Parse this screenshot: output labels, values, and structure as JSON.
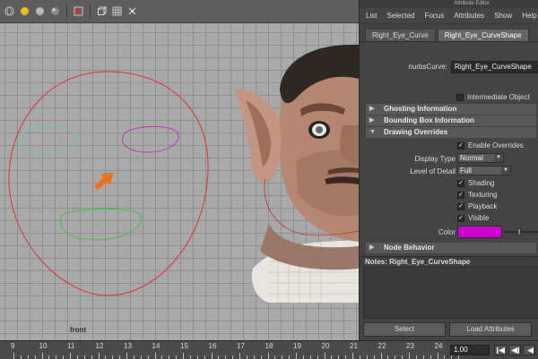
{
  "viewport": {
    "camera_label": "front",
    "toolbar_icons": [
      "wireframe-sphere-icon",
      "smooth-shade-yellow-icon",
      "smooth-shade-gray-icon",
      "shaded-sphere-icon",
      "xray-icon",
      "cube-icon",
      "grid-icon",
      "joint-icon"
    ]
  },
  "attribute_editor": {
    "window_title": "Attribute Editor",
    "menu": [
      "List",
      "Selected",
      "Focus",
      "Attributes",
      "Show",
      "Help"
    ],
    "tabs": [
      {
        "label": "Right_Eye_Curve",
        "active": false
      },
      {
        "label": "Right_Eye_CurveShape",
        "active": true
      }
    ],
    "node_type_label": "nurbsCurve:",
    "node_name": "Right_Eye_CurveShape",
    "intermediate_object_label": "Intermediate Object",
    "sections": {
      "ghosting": "Ghosting Information",
      "bounding_box": "Bounding Box Information",
      "drawing_overrides": "Drawing Overrides",
      "node_behavior": "Node Behavior"
    },
    "drawing_overrides": {
      "enable_overrides_label": "Enable Overrides",
      "display_type_label": "Display Type",
      "display_type_value": "Normal",
      "level_of_detail_label": "Level of Detail",
      "level_of_detail_value": "Full",
      "shading_label": "Shading",
      "texturing_label": "Texturing",
      "playback_label": "Playback",
      "visible_label": "Visible",
      "color_label": "Color",
      "color_value": "#d000d0",
      "check_mark": "✓"
    },
    "notes_label": "Notes:  Right_Eye_CurveShape",
    "buttons": {
      "select": "Select",
      "load_attributes": "Load Attributes"
    }
  },
  "timeline": {
    "frame_labels": [
      "9",
      "10",
      "11",
      "12",
      "13",
      "14",
      "15",
      "16",
      "17",
      "18",
      "19",
      "20",
      "21",
      "22",
      "23",
      "24"
    ],
    "current_frame": "1.00"
  },
  "colors": {
    "face_outline": "#e03030",
    "left_eye_curve": "#6ec9a0",
    "right_eye_curve": "#c030c0",
    "mouth_curve": "#40c040",
    "arrow": "#f07010",
    "override_color": "#d000d0"
  }
}
